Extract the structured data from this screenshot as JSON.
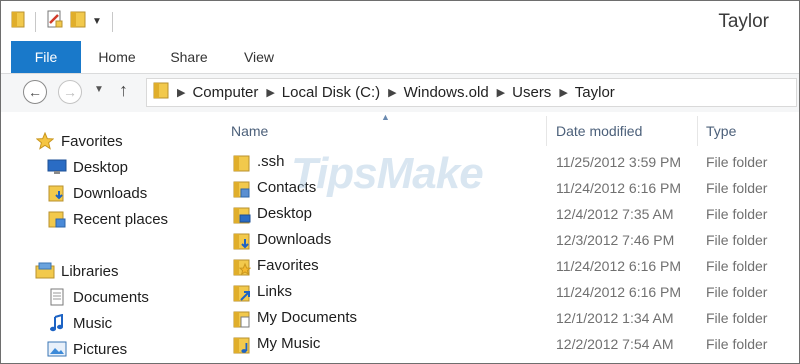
{
  "window": {
    "title": "Taylor"
  },
  "ribbon": {
    "tabs": {
      "file": "File",
      "home": "Home",
      "share": "Share",
      "view": "View"
    }
  },
  "address": {
    "crumbs": [
      "Computer",
      "Local Disk (C:)",
      "Windows.old",
      "Users",
      "Taylor"
    ]
  },
  "navigation": {
    "favorites": {
      "label": "Favorites",
      "items": [
        "Desktop",
        "Downloads",
        "Recent places"
      ]
    },
    "libraries": {
      "label": "Libraries",
      "items": [
        "Documents",
        "Music",
        "Pictures"
      ]
    }
  },
  "columns": {
    "name": "Name",
    "date": "Date modified",
    "type": "Type"
  },
  "files": [
    {
      "name": ".ssh",
      "date": "11/25/2012 3:59 PM",
      "type": "File folder",
      "icon": "folder-icon"
    },
    {
      "name": "Contacts",
      "date": "11/24/2012 6:16 PM",
      "type": "File folder",
      "icon": "contacts-folder-icon"
    },
    {
      "name": "Desktop",
      "date": "12/4/2012 7:35 AM",
      "type": "File folder",
      "icon": "desktop-folder-icon"
    },
    {
      "name": "Downloads",
      "date": "12/3/2012 7:46 PM",
      "type": "File folder",
      "icon": "downloads-folder-icon"
    },
    {
      "name": "Favorites",
      "date": "11/24/2012 6:16 PM",
      "type": "File folder",
      "icon": "favorites-folder-icon"
    },
    {
      "name": "Links",
      "date": "11/24/2012 6:16 PM",
      "type": "File folder",
      "icon": "links-folder-icon"
    },
    {
      "name": "My Documents",
      "date": "12/1/2012 1:34 AM",
      "type": "File folder",
      "icon": "documents-folder-icon"
    },
    {
      "name": "My Music",
      "date": "12/2/2012 7:54 AM",
      "type": "File folder",
      "icon": "music-folder-icon"
    }
  ],
  "watermark": "TipsMake",
  "colors": {
    "file_tab": "#1979ca",
    "folder": "#f2c94c",
    "column_header": "#4c607a"
  }
}
